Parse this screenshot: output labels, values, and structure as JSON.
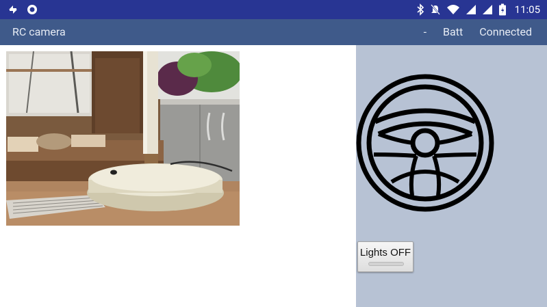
{
  "status_bar": {
    "time": "11:05",
    "left_icons": [
      "sync-icon",
      "circle-app-icon"
    ],
    "right_icons": [
      "bluetooth-icon",
      "mute-icon",
      "wifi-icon",
      "signal-icon",
      "signal-icon",
      "battery-icon"
    ]
  },
  "app_bar": {
    "title": "RC camera",
    "dash": "-",
    "batt": "Batt",
    "connection": "Connected"
  },
  "controls": {
    "steering_icon": "steering-wheel-icon",
    "lights_label": "Lights OFF",
    "lights_on": false
  },
  "colors": {
    "status_bar": "#283593",
    "app_bar": "#3f5a8a",
    "panel": "#b7c2d4"
  }
}
